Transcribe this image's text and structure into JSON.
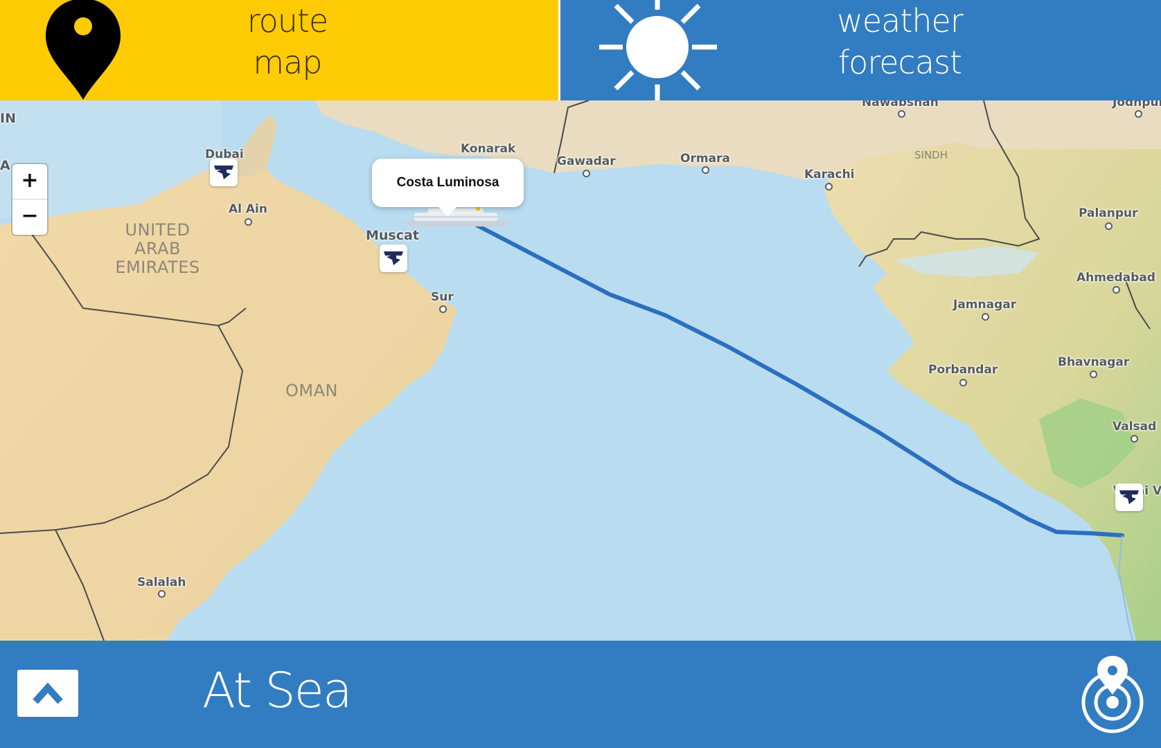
{
  "tabs": {
    "route": {
      "line1": "route",
      "line2": "map",
      "icon": "map-pin-icon",
      "color": "#ffcb05"
    },
    "weather": {
      "line1": "weather",
      "line2": "forecast",
      "icon": "sun-icon",
      "color": "#327cc2"
    }
  },
  "map": {
    "zoom_in_label": "+",
    "zoom_out_label": "−",
    "popup_title": "Costa Luminosa",
    "route_color": "#2a6fc0",
    "places": {
      "edge_in": "IN",
      "edge_a": "A",
      "dubai": "Dubai",
      "al_ain": "Al Ain",
      "muscat": "Muscat",
      "sur": "Sur",
      "salalah": "Salalah",
      "konarak": "Konarak",
      "gawadar": "Gawadar",
      "ormara": "Ormara",
      "karachi": "Karachi",
      "nawabshah": "Nawabshah",
      "jodhpur": "Jodhpur",
      "palanpur": "Palanpur",
      "ahmedabad": "Ahmedabad",
      "jamnagar": "Jamnagar",
      "porbandar": "Porbandar",
      "bhavnagar": "Bhavnagar",
      "valsad": "Valsad",
      "vasai_virar": "Vasai Virar"
    },
    "regions": {
      "uae_line1": "UNITED",
      "uae_line2": "ARAB",
      "uae_line3": "EMIRATES",
      "oman": "OMAN",
      "sindh": "SINDH"
    }
  },
  "footer": {
    "status": "At Sea",
    "up_icon": "chevron-up-icon",
    "locate_icon": "locate-ship-icon",
    "color": "#327cc2"
  }
}
